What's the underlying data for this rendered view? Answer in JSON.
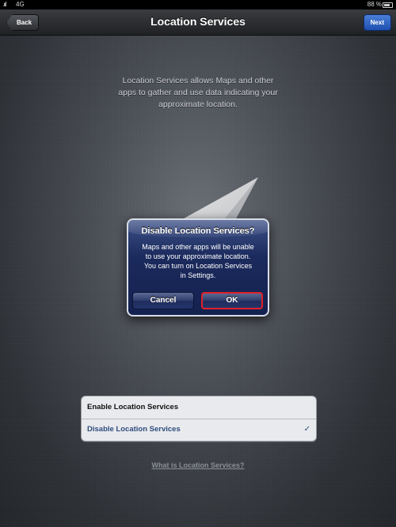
{
  "status_bar": {
    "signal": ".ııl",
    "network": "4G",
    "battery_percent": "88 %"
  },
  "nav": {
    "title": "Location Services",
    "back_label": "Back",
    "next_label": "Next"
  },
  "intro": {
    "text": "Location Services allows Maps and other apps to gather and use data indicating your approximate location."
  },
  "alert": {
    "title": "Disable Location Services?",
    "message_lines": [
      "Maps and other apps will be unable",
      "to use your approximate location.",
      "You can turn on Location Services",
      "in Settings."
    ],
    "cancel_label": "Cancel",
    "ok_label": "OK"
  },
  "options": {
    "items": [
      {
        "label": "Enable Location Services",
        "selected": false
      },
      {
        "label": "Disable Location Services",
        "selected": true
      }
    ],
    "check_glyph": "✓"
  },
  "help_link": "What is Location Services?",
  "colors": {
    "alert_bg": "#1b2a5c",
    "ok_highlight": "#e0202a",
    "selected_option": "#2f4c7e",
    "next_button": "#2f63c4"
  }
}
